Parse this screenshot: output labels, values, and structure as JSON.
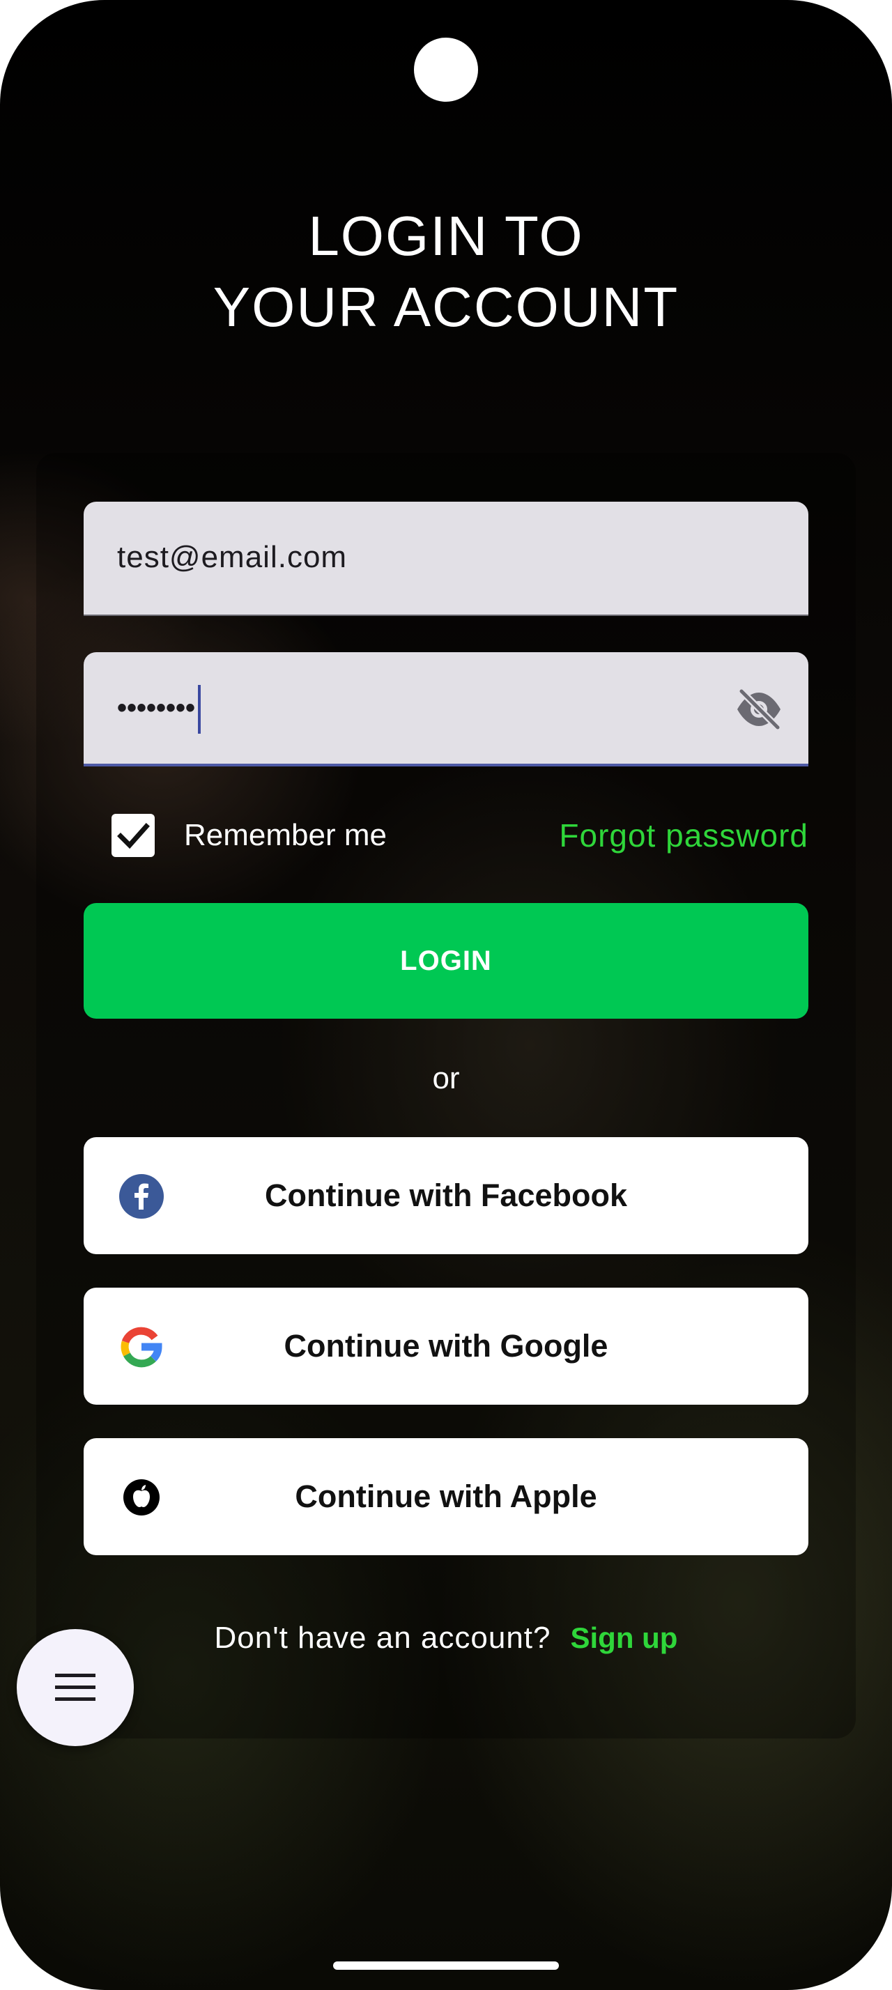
{
  "header": {
    "title_line1": "LOGIN TO",
    "title_line2": "YOUR ACCOUNT"
  },
  "form": {
    "email_value": "test@email.com",
    "password_value": "••••••••",
    "password_visibility_icon": "eye-off-icon",
    "remember_label": "Remember me",
    "remember_checked": true,
    "forgot_label": "Forgot password",
    "login_label": "LOGIN"
  },
  "divider": {
    "or_label": "or"
  },
  "social": {
    "facebook_label": "Continue with Facebook",
    "google_label": "Continue with Google",
    "apple_label": "Continue with Apple"
  },
  "footer": {
    "signup_prompt": "Don't have an account?",
    "signup_link": "Sign up"
  },
  "fab": {
    "icon": "menu-icon"
  },
  "colors": {
    "accent_green": "#00c853",
    "link_green": "#2fd63a",
    "field_bg": "#e2e0e6",
    "focus_underline": "#4e5aa6",
    "facebook_blue": "#3b5998"
  }
}
